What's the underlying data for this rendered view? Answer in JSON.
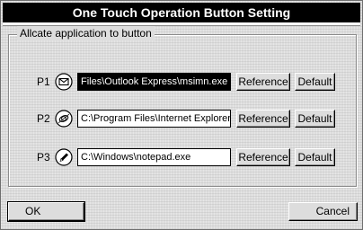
{
  "window": {
    "title": "One Touch Operation Button Setting"
  },
  "group": {
    "title": "Allcate application to button"
  },
  "rows": [
    {
      "label": "P1",
      "icon": "mail-envelope-icon",
      "path": "Files\\Outlook Express\\msimn.exe",
      "selected": true,
      "reference_label": "Reference",
      "default_label": "Default"
    },
    {
      "label": "P2",
      "icon": "internet-globe-icon",
      "path": "C:\\Program Files\\Internet Explorer\\",
      "selected": false,
      "reference_label": "Reference",
      "default_label": "Default"
    },
    {
      "label": "P3",
      "icon": "pencil-icon",
      "path": "C:\\Windows\\notepad.exe",
      "selected": false,
      "reference_label": "Reference",
      "default_label": "Default"
    }
  ],
  "footer": {
    "ok_label": "OK",
    "cancel_label": "Cancel"
  }
}
